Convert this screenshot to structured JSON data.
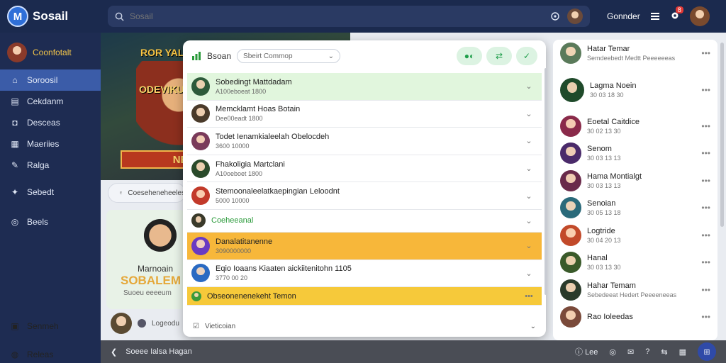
{
  "app": {
    "logo_letter": "M",
    "name": "Sosail"
  },
  "search": {
    "placeholder": "Sosail",
    "right_icons": [
      "connect-icon",
      "profile-avatar"
    ]
  },
  "topbar": {
    "label": "Gonnder",
    "notification_count": "8"
  },
  "sidebar": {
    "profile_name": "Coonfotalt",
    "items": [
      {
        "label": "Soroosil",
        "icon": "house-icon",
        "active": true
      },
      {
        "label": "Cekdanm",
        "icon": "clipboard-icon"
      },
      {
        "label": "Desceas",
        "icon": "camera-icon"
      },
      {
        "label": "Maeriies",
        "icon": "blocks-icon"
      },
      {
        "label": "Ralga",
        "icon": "pen-icon"
      },
      {
        "label": "Sebedt",
        "icon": "pin-icon"
      },
      {
        "label": "Beels",
        "icon": "target-icon"
      }
    ],
    "bottom_items": [
      {
        "label": "Senmeh",
        "icon": "settings-icon"
      },
      {
        "label": "Releas",
        "icon": "globe-icon"
      }
    ]
  },
  "banner": {
    "title_top": "ROR YAL",
    "title_mid": "ODEVIKU",
    "ribbon": "NERUE"
  },
  "left_chip": {
    "text": "Coeseheneheeles"
  },
  "card": {
    "name": "Marnoain",
    "big": "SOBALEM",
    "sub": "Suoeu eeeeum"
  },
  "left_footer": {
    "text": "Logeodu"
  },
  "dropdown": {
    "title": "Bsoan",
    "select_placeholder": "Sbeirt Commop",
    "rows": [
      {
        "title": "Sobedingt Mattdadam",
        "sub": "A100eboeat 1800",
        "style": "green"
      },
      {
        "title": "Memcklamt Hoas Botain",
        "sub": "Dee00eadt 1800"
      },
      {
        "title": "Todet Ienamkialeelah Obelocdeh",
        "sub": "3600 10000"
      },
      {
        "title": "Fhakoligia Martclani",
        "sub": "A10oeboet 1800"
      },
      {
        "title": "Stemoonaleelatkaepingian Leloodnt",
        "sub": "5000 10000"
      },
      {
        "title": "Coeheeanal",
        "sub": "",
        "style": "plain"
      },
      {
        "title": "Danalatitanenne",
        "sub": "3090000000",
        "style": "orange"
      },
      {
        "title": "Eqio Ioaans Kiaaten aickiitenitohn 1105",
        "sub": "3770 00 20"
      },
      {
        "title": "Obseonenenekeht Temon",
        "sub": "",
        "style": "yellow"
      }
    ],
    "footer": "Vieticoian"
  },
  "friends": [
    {
      "name": "Hatar Temar",
      "sub": "Semdeebedt Medtt Peeeeeeas"
    },
    {
      "name": "Lagma Noein",
      "sub": "30 03 18 30"
    },
    {
      "name": "Eoetal Caitdice",
      "sub": "30 02 13 30"
    },
    {
      "name": "Senom",
      "sub": "30 03 13 13"
    },
    {
      "name": "Hama Montialgt",
      "sub": "30 03 13 13"
    },
    {
      "name": "Senoian",
      "sub": "30 05 13 18"
    },
    {
      "name": "Logtride",
      "sub": "30 04 20 13"
    },
    {
      "name": "Hanal",
      "sub": "30 03 13 30"
    },
    {
      "name": "Hahar Temam",
      "sub": "Sebedeeat Hedert Peeeeneeas"
    },
    {
      "name": "Rao Ioleedas",
      "sub": ""
    }
  ],
  "bottombar": {
    "text": "Soeee Ialsa Hagan",
    "badge1": "Lee",
    "icons": [
      "info-icon",
      "refresh-icon",
      "chat-icon",
      "help-icon",
      "share-icon",
      "archive-icon",
      "grid-icon"
    ]
  },
  "colors": {
    "top": "#1b2a4e",
    "sidebar": "#1e2c52",
    "accent": "#3b5ca8",
    "green": "#e1f6dd",
    "orange": "#f7b73a",
    "yellow": "#f6c93a"
  }
}
